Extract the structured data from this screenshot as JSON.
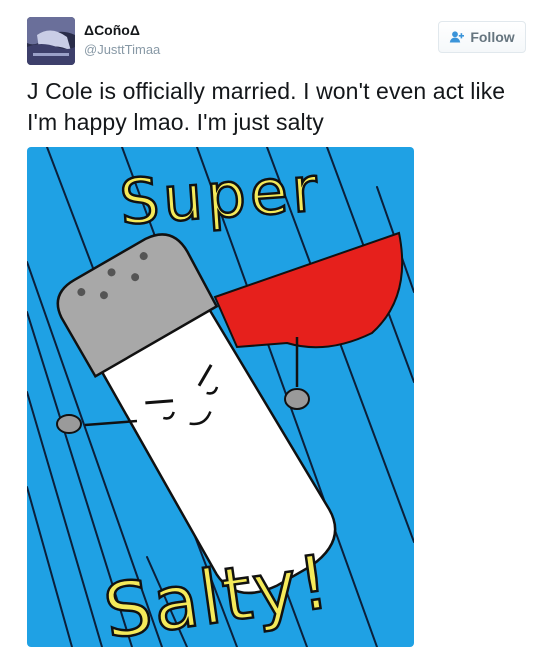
{
  "tweet": {
    "display_name": "ΔCoñoΔ",
    "handle": "@JusttTimaa",
    "text": "J Cole is officially married. I won't even act like I'm happy lmao. I'm just salty",
    "follow_label": "Follow",
    "follow_icon": "add-user-icon",
    "accent_color": "#66757f"
  },
  "media": {
    "drawing": {
      "top_word": "Super",
      "bottom_word": "Salty!",
      "background_color": "#1fa1e4",
      "cape_color": "#e6201c",
      "lettering_color": "#f5ea5a"
    }
  }
}
